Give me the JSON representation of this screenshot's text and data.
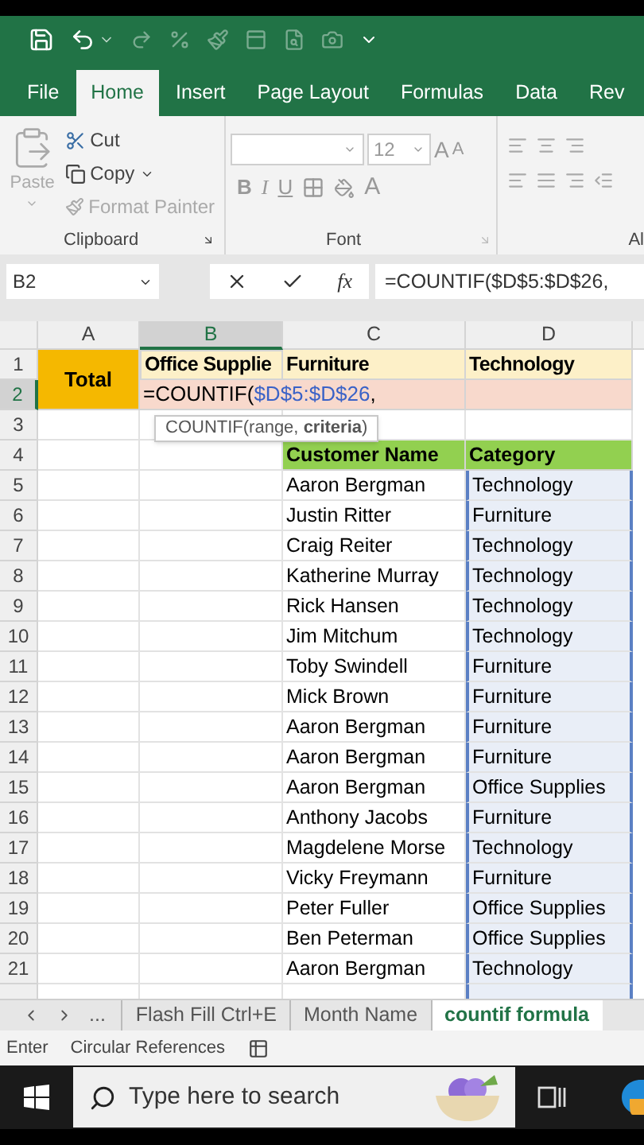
{
  "ribbon_tabs": [
    {
      "label": "File",
      "selected": false
    },
    {
      "label": "Home",
      "selected": true
    },
    {
      "label": "Insert",
      "selected": false
    },
    {
      "label": "Page Layout",
      "selected": false
    },
    {
      "label": "Formulas",
      "selected": false
    },
    {
      "label": "Data",
      "selected": false
    },
    {
      "label": "Rev",
      "selected": false
    }
  ],
  "clipboard": {
    "paste": "Paste",
    "cut": "Cut",
    "copy": "Copy",
    "format_painter": "Format Painter",
    "label": "Clipboard"
  },
  "font": {
    "size": "12",
    "grow": "A",
    "shrink": "A",
    "bold": "B",
    "italic": "I",
    "underline": "U",
    "font_color": "A",
    "label": "Font"
  },
  "alignment": {
    "label": "Al"
  },
  "formula_bar": {
    "name_box": "B2",
    "fx": "fx",
    "formula": "=COUNTIF($D$5:$D$26,"
  },
  "columns": [
    {
      "label": "A",
      "selected": false
    },
    {
      "label": "B",
      "selected": true
    },
    {
      "label": "C",
      "selected": false
    },
    {
      "label": "D",
      "selected": false
    }
  ],
  "row_numbers": [
    {
      "label": "1",
      "selected": false
    },
    {
      "label": "2",
      "selected": true
    },
    {
      "label": "3",
      "selected": false
    },
    {
      "label": "4",
      "selected": false
    },
    {
      "label": "5",
      "selected": false
    },
    {
      "label": "6",
      "selected": false
    },
    {
      "label": "7",
      "selected": false
    },
    {
      "label": "8",
      "selected": false
    },
    {
      "label": "9",
      "selected": false
    },
    {
      "label": "10",
      "selected": false
    },
    {
      "label": "11",
      "selected": false
    },
    {
      "label": "12",
      "selected": false
    },
    {
      "label": "13",
      "selected": false
    },
    {
      "label": "14",
      "selected": false
    },
    {
      "label": "15",
      "selected": false
    },
    {
      "label": "16",
      "selected": false
    },
    {
      "label": "17",
      "selected": false
    },
    {
      "label": "18",
      "selected": false
    },
    {
      "label": "19",
      "selected": false
    },
    {
      "label": "20",
      "selected": false
    },
    {
      "label": "21",
      "selected": false
    }
  ],
  "summary": {
    "total": "Total",
    "categories": [
      "Office Supplie",
      "Furniture",
      "Technology"
    ]
  },
  "edit_cell": [
    {
      "text": "=COUNTIF(",
      "kind": "plain"
    },
    {
      "text": "$D$5:$D$26",
      "kind": "reference"
    },
    {
      "text": ",",
      "kind": "plain"
    }
  ],
  "tooltip": {
    "signature": "COUNTIF(range,",
    "current_argument": "criteria",
    "close": ")"
  },
  "table": {
    "columns": [
      "Customer Name",
      "Category"
    ],
    "rows": [
      [
        "Aaron Bergman",
        "Technology"
      ],
      [
        "Justin Ritter",
        "Furniture"
      ],
      [
        "Craig Reiter",
        "Technology"
      ],
      [
        "Katherine Murray",
        "Technology"
      ],
      [
        "Rick Hansen",
        "Technology"
      ],
      [
        "Jim Mitchum",
        "Technology"
      ],
      [
        "Toby Swindell",
        "Furniture"
      ],
      [
        "Mick Brown",
        "Furniture"
      ],
      [
        "Aaron Bergman",
        "Furniture"
      ],
      [
        "Aaron Bergman",
        "Furniture"
      ],
      [
        "Aaron Bergman",
        "Office Supplies"
      ],
      [
        "Anthony Jacobs",
        "Furniture"
      ],
      [
        "Magdelene Morse",
        "Technology"
      ],
      [
        "Vicky Freymann",
        "Furniture"
      ],
      [
        "Peter Fuller",
        "Office Supplies"
      ],
      [
        "Ben Peterman",
        "Office Supplies"
      ],
      [
        "Aaron Bergman",
        "Technology"
      ]
    ]
  },
  "sheet_nav": "...",
  "sheet_tabs": [
    {
      "label": "Flash Fill Ctrl+E",
      "selected": false
    },
    {
      "label": "Month Name",
      "selected": false
    },
    {
      "label": "countif formula",
      "selected": true
    }
  ],
  "status_bar": {
    "mode": "Enter",
    "circular": "Circular References"
  },
  "taskbar": {
    "search_placeholder": "Type here to search"
  }
}
